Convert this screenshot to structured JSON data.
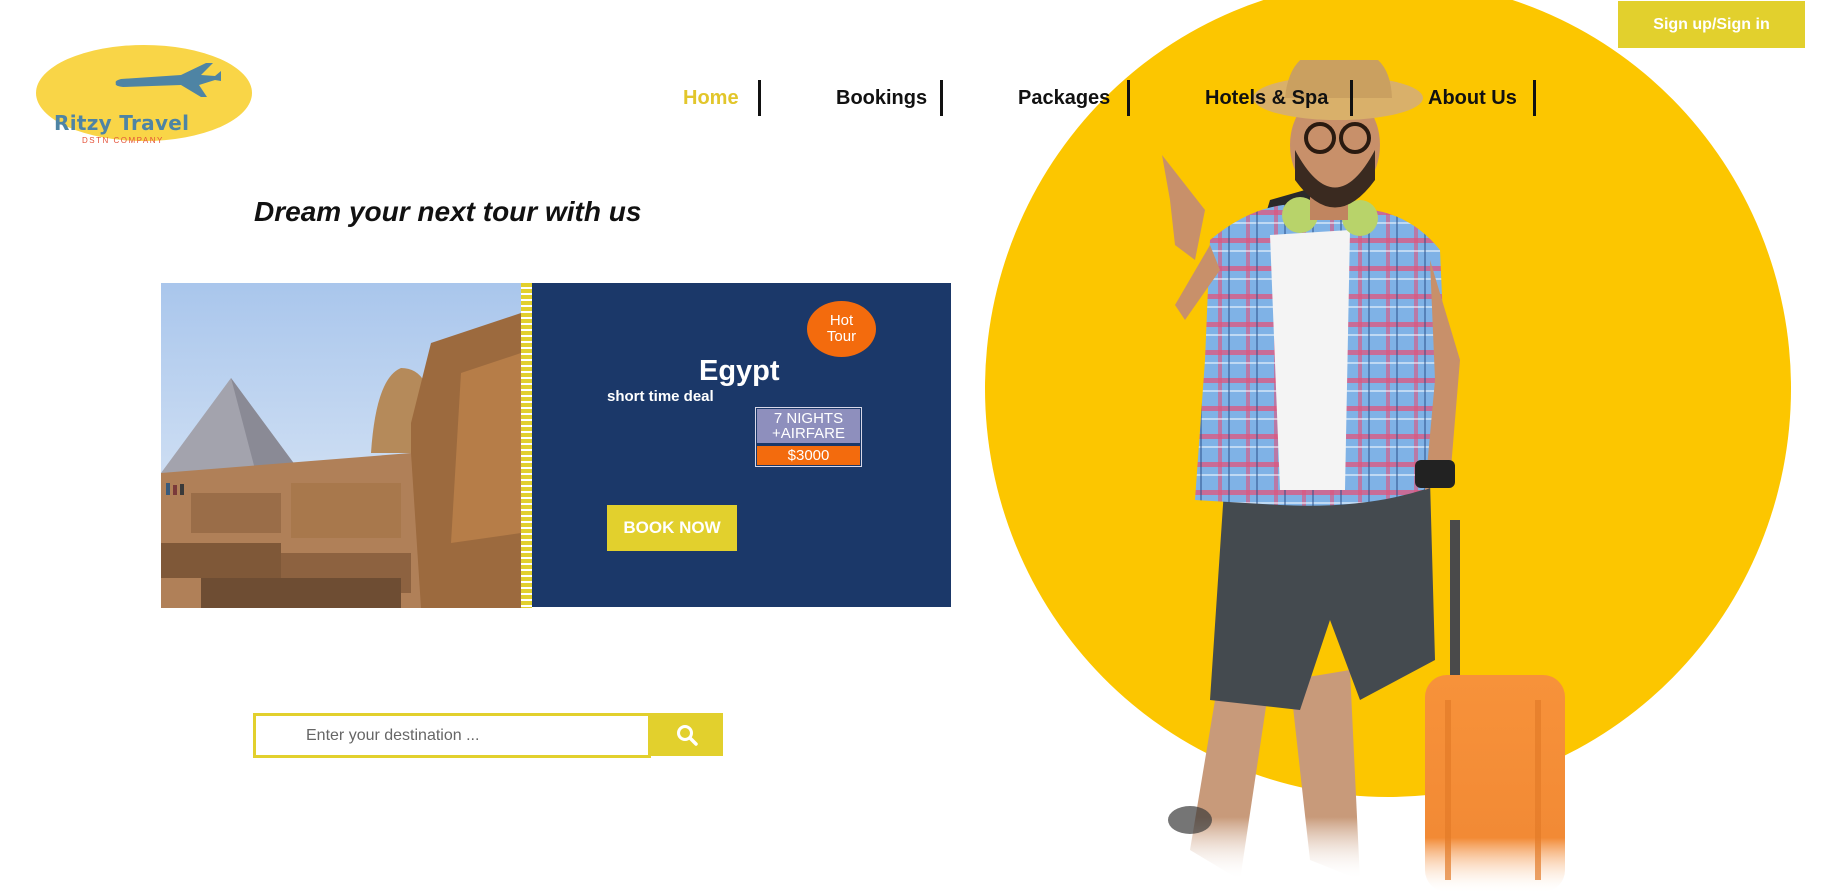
{
  "header": {
    "logo": {
      "title": "Ritzy Travel",
      "subtitle": "DSTN COMPANY",
      "icon": "airplane-icon"
    },
    "signup_label": "Sign up/Sign in",
    "nav": [
      {
        "label": "Home",
        "active": true
      },
      {
        "label": "Bookings",
        "active": false
      },
      {
        "label": "Packages",
        "active": false
      },
      {
        "label": "Hotels & Spa",
        "active": false
      },
      {
        "label": "About Us",
        "active": false
      }
    ]
  },
  "hero": {
    "tagline": "Dream your next tour with us"
  },
  "promo": {
    "badge_line1": "Hot",
    "badge_line2": "Tour",
    "destination": "Egypt",
    "deal_text": "short time deal",
    "nights_line1": "7 NIGHTS",
    "nights_line2": "+AIRFARE",
    "price": "$3000",
    "book_label": "BOOK NOW"
  },
  "search": {
    "placeholder": "Enter your destination ...",
    "button_icon": "search-icon"
  },
  "colors": {
    "accent_yellow": "#e2d02d",
    "hero_yellow": "#fcc600",
    "navy": "#1b3869",
    "orange": "#f36b0d",
    "lavender": "#8e8fbd"
  }
}
